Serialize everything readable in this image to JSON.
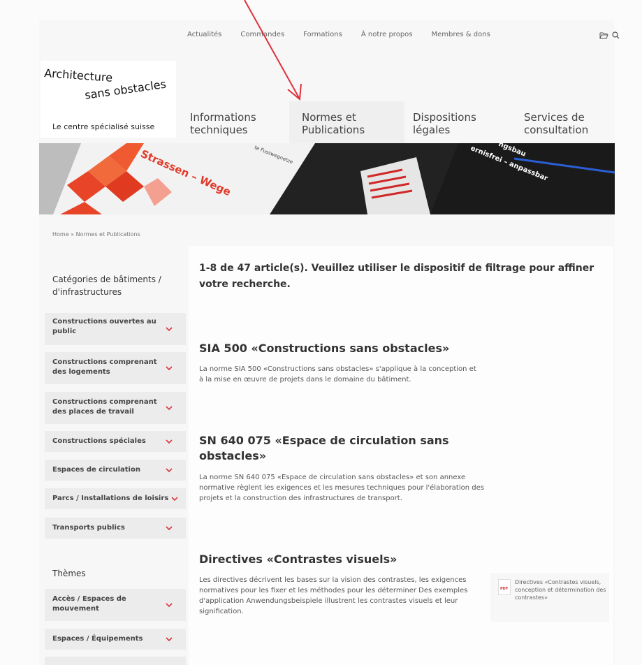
{
  "topnav": [
    "Actualités",
    "Commandes",
    "Formations",
    "À notre propos",
    "Membres & dons"
  ],
  "icons": [
    "folder-icon",
    "search-icon"
  ],
  "logo": {
    "line1": "Architecture",
    "line2": "sans obstacles",
    "tagline": "Le centre spécialisé suisse"
  },
  "mainnav": [
    {
      "label": "Informations techniques"
    },
    {
      "label": "Normes et Publications",
      "active": true
    },
    {
      "label": "Dispositions légales"
    },
    {
      "label": "Services de consultation"
    }
  ],
  "hero": {
    "text_left": "Strassen – Wege",
    "text_small": "te Fusswegnetze",
    "text_right1": "ngsbau",
    "text_right2": "ernisfrei – anpassbar"
  },
  "breadcrumb": "Home » Normes et Publications",
  "sidebar": {
    "heading1": "Catégories de bâtiments / d'infrastructures",
    "categories": [
      "Constructions ouvertes au public",
      "Constructions comprenant des logements",
      "Constructions comprenant des places de travail",
      "Constructions spéciales",
      "Espaces de circulation",
      "Parcs / Installations de loisirs",
      "Transports publics"
    ],
    "heading2": "Thèmes",
    "themes": [
      "Accès / Espaces de mouvement",
      "Espaces / Équipements"
    ]
  },
  "results": {
    "count_text": "1-8 de 47 article(s). Veuillez utiliser le dispositif de filtrage pour affiner votre recherche."
  },
  "articles": [
    {
      "title": "SIA 500 «Constructions sans obstacles»",
      "text": "La norme SIA 500 «Constructions sans obstacles» s'applique à la conception et à la mise en œuvre de projets dans le domaine du bâtiment."
    },
    {
      "title": "SN 640 075 «Espace de circulation sans obstacles»",
      "text": "La norme SN 640 075 «Espace de circulation sans obstacles» et son annexe normative règlent les exigences et les mesures techniques pour l'élaboration des projets et la construction des infrastructures de transport."
    },
    {
      "title": "Directives «Contrastes visuels»",
      "text": "Les directives décrivent les bases sur la vision des contrastes, les exigences normatives pour les fixer et les méthodes pour les déterminer Des exemples d'application Anwendungsbeispiele illustrent les contrastes visuels et leur signification.",
      "pdf_label": "Directives «Contrastes visuels, conception et détermination des contrastes»",
      "pdf_tag": "PDF"
    }
  ],
  "colors": {
    "accent_red": "#e0303a",
    "chevron": "#d9363e"
  }
}
